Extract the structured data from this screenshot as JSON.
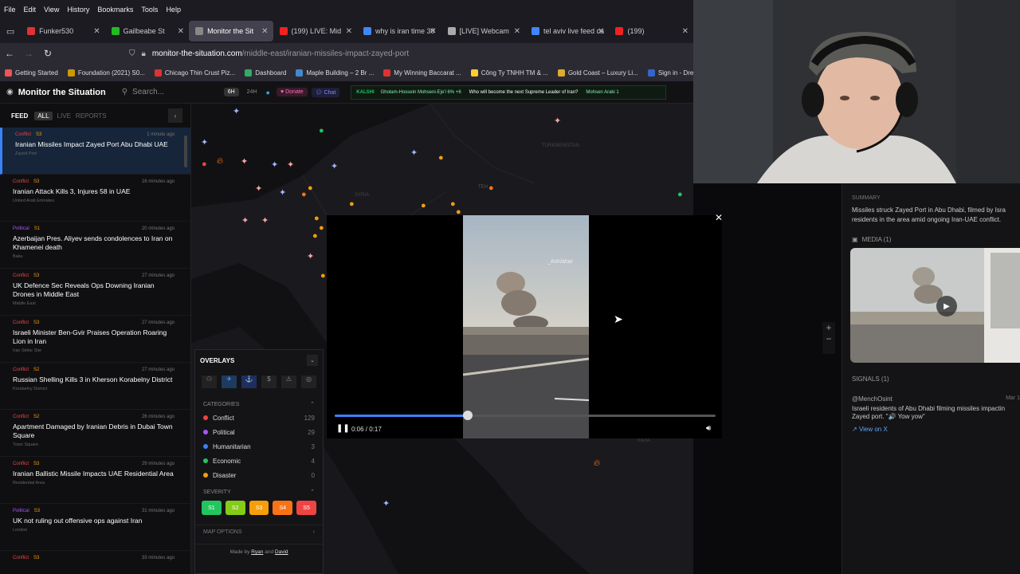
{
  "menu": [
    "File",
    "Edit",
    "View",
    "History",
    "Bookmarks",
    "Tools",
    "Help"
  ],
  "tabs": [
    {
      "label": "Funker530",
      "color": "#d33"
    },
    {
      "label": "Gailbeabe St",
      "color": "#2b2"
    },
    {
      "label": "Monitor the Sit",
      "color": "#888",
      "active": true
    },
    {
      "label": "(199) LIVE: Mid",
      "color": "#e22"
    },
    {
      "label": "why is iran time 30",
      "color": "#4285f4"
    },
    {
      "label": "[LIVE] Webcam",
      "color": "#aaa"
    },
    {
      "label": "tel aviv live feed ca",
      "color": "#4285f4"
    },
    {
      "label": "(199)",
      "color": "#e22"
    }
  ],
  "url": {
    "host": "monitor-the-situation.com",
    "path": "/middle-east/iranian-missiles-impact-zayed-port"
  },
  "bookmarks": [
    {
      "label": "Getting Started",
      "color": "#e55"
    },
    {
      "label": "Foundation (2021) S0...",
      "color": "#c90"
    },
    {
      "label": "Chicago Thin Crust Piz...",
      "color": "#d33"
    },
    {
      "label": "Dashboard",
      "color": "#3a6"
    },
    {
      "label": "Maple Building – 2 Br ...",
      "color": "#48c"
    },
    {
      "label": "My Winning Baccarat ...",
      "color": "#d33"
    },
    {
      "label": "Công Ty TNHH TM & ...",
      "color": "#fc3"
    },
    {
      "label": "Gold Coast – Luxury Li...",
      "color": "#da3"
    },
    {
      "label": "Sign in - Drea",
      "color": "#36c"
    }
  ],
  "app": {
    "title": "Monitor the Situation",
    "search_placeholder": "Search...",
    "range_a": "6H",
    "range_b": "24H",
    "donate": "Donate",
    "chat": "Chat",
    "ticker_src": "KALSHI",
    "ticker_a": "Gholam-Hossein Mohseni-Eje'i 6% +6",
    "ticker_b": "Who will become the next Supreme Leader of Iran?",
    "ticker_c": "Mohsen Araki 1"
  },
  "feed": {
    "label": "FEED",
    "tab_all": "ALL",
    "tab_live": "LIVE",
    "tab_reports": "REPORTS",
    "items": [
      {
        "cat": "Conflict",
        "sev": "S3",
        "time": "1 minute ago",
        "title": "Iranian Missiles Impact Zayed Port Abu Dhabi UAE",
        "loc": "Zayed Port",
        "catColor": "#ef4444"
      },
      {
        "cat": "Conflict",
        "sev": "S3",
        "time": "16 minutes ago",
        "title": "Iranian Attack Kills 3, Injures 58 in UAE",
        "loc": "United Arab Emirates",
        "catColor": "#ef4444"
      },
      {
        "cat": "Political",
        "sev": "S1",
        "time": "20 minutes ago",
        "title": "Azerbaijan Pres. Aliyev sends condolences to Iran on Khamenei death",
        "loc": "Baku",
        "catColor": "#a855f7"
      },
      {
        "cat": "Conflict",
        "sev": "S3",
        "time": "27 minutes ago",
        "title": "UK Defence Sec Reveals Ops Downing Iranian Drones in Middle East",
        "loc": "Middle East",
        "catColor": "#ef4444"
      },
      {
        "cat": "Conflict",
        "sev": "S3",
        "time": "27 minutes ago",
        "title": "Israeli Minister Ben-Gvir Praises Operation Roaring Lion in Iran",
        "loc": "Iran Strike Site",
        "catColor": "#ef4444"
      },
      {
        "cat": "Conflict",
        "sev": "S2",
        "time": "27 minutes ago",
        "title": "Russian Shelling Kills 3 in Kherson Korabelny District",
        "loc": "Korabelny District",
        "catColor": "#ef4444"
      },
      {
        "cat": "Conflict",
        "sev": "S2",
        "time": "26 minutes ago",
        "title": "Apartment Damaged by Iranian Debris in Dubai Town Square",
        "loc": "Town Square",
        "catColor": "#ef4444"
      },
      {
        "cat": "Conflict",
        "sev": "S3",
        "time": "29 minutes ago",
        "title": "Iranian Ballistic Missile Impacts UAE Residential Area",
        "loc": "Residential Area",
        "catColor": "#ef4444"
      },
      {
        "cat": "Political",
        "sev": "S3",
        "time": "31 minutes ago",
        "title": "UK not ruling out offensive ops against Iran",
        "loc": "London",
        "catColor": "#a855f7"
      },
      {
        "cat": "Conflict",
        "sev": "S3",
        "time": "33 minutes ago",
        "title": "",
        "loc": "",
        "catColor": "#ef4444"
      }
    ]
  },
  "overlays": {
    "title": "OVERLAYS",
    "categories_label": "CATEGORIES",
    "categories": [
      {
        "name": "Conflict",
        "count": "129",
        "color": "#ef4444"
      },
      {
        "name": "Political",
        "count": "29",
        "color": "#a855f7"
      },
      {
        "name": "Humanitarian",
        "count": "3",
        "color": "#3b82f6"
      },
      {
        "name": "Economic",
        "count": "4",
        "color": "#22c55e"
      },
      {
        "name": "Disaster",
        "count": "0",
        "color": "#f59e0b"
      }
    ],
    "severity_label": "SEVERITY",
    "severity": [
      {
        "label": "S1",
        "color": "#22c55e"
      },
      {
        "label": "S2",
        "color": "#84cc16"
      },
      {
        "label": "S3",
        "color": "#f59e0b"
      },
      {
        "label": "S4",
        "color": "#f97316"
      },
      {
        "label": "S5",
        "color": "#ef4444"
      }
    ],
    "map_options": "MAP OPTIONS",
    "credit_a": "Made by ",
    "credit_b": "Ryan",
    "credit_c": " and ",
    "credit_d": "David"
  },
  "map_labels": [
    "SYRIA",
    "TURKMENISTAN",
    "TEH",
    "INDIA"
  ],
  "video": {
    "time": "0:06 / 0:17",
    "progress": 0.35,
    "watermark": "_Ash/ahar"
  },
  "detail": {
    "summary_label": "SUMMARY",
    "summary": "Missiles struck Zayed Port in Abu Dhabi, filmed by Isra residents in the area amid ongoing Iran-UAE conflict.",
    "media_label": "MEDIA (1)",
    "signals_label": "SIGNALS (1)",
    "signal_user": "@MenchOsint",
    "signal_date": "Mar 1",
    "signal_text": "Israeli residents of Abu Dhabi filming missiles impactin Zayed port. \"🔊 Yow yow\"",
    "view_link": "View on X"
  }
}
